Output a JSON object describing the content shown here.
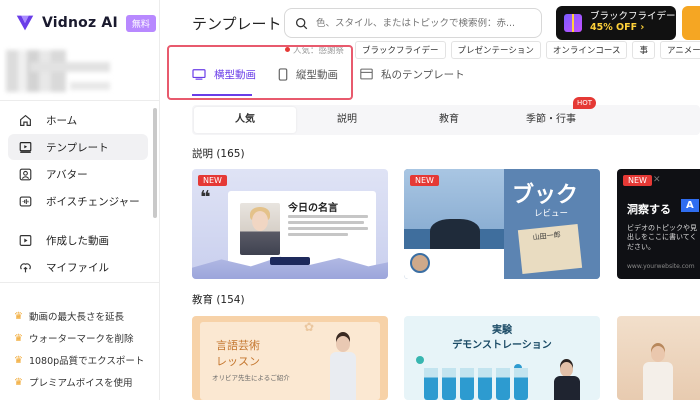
{
  "brand": {
    "name": "Vidnoz AI",
    "badge": "無料"
  },
  "sidebar": {
    "nav": [
      {
        "label": "ホーム",
        "icon": "home-icon"
      },
      {
        "label": "テンプレート",
        "icon": "template-icon",
        "active": true
      },
      {
        "label": "アバター",
        "icon": "avatar-icon"
      },
      {
        "label": "ボイスチェンジャー",
        "icon": "voice-changer-icon"
      },
      {
        "label": "作成した動画",
        "icon": "play-icon"
      },
      {
        "label": "マイファイル",
        "icon": "upload-icon"
      }
    ],
    "premium": [
      "動画の最大長さを延長",
      "ウォーターマークを削除",
      "1080p品質でエクスポート",
      "プレミアムボイスを使用"
    ]
  },
  "header": {
    "title": "テンプレート",
    "search_placeholder": "色、スタイル、またはトピックで検索例：赤...",
    "promo_title": "ブラックフライデー",
    "promo_sub": "45% OFF ›"
  },
  "tags": [
    "人気：感謝祭",
    "ブラックフライデー",
    "プレゼンテーション",
    "オンラインコース",
    "事",
    "アニメーション"
  ],
  "orientation_tabs": [
    {
      "label": "横型動画",
      "active": true
    },
    {
      "label": "縦型動画"
    },
    {
      "label": "私のテンプレート"
    }
  ],
  "categories": [
    {
      "label": "人気",
      "active": true
    },
    {
      "label": "説明"
    },
    {
      "label": "教育"
    },
    {
      "label": "季節・行事",
      "badge": "HOT"
    }
  ],
  "sections": [
    {
      "title": "説明 (165)",
      "cards": [
        {
          "badge": "NEW",
          "title": "今日の名言"
        },
        {
          "badge": "NEW",
          "title": "ブック",
          "subtitle": "レビュー",
          "note": "山田一郎"
        },
        {
          "badge": "NEW",
          "title": "洞察する",
          "accent": "A",
          "text": "ビデオのトピックや見出しをここに書いてください。",
          "url": "www.yourwebsite.com"
        }
      ]
    },
    {
      "title": "教育 (154)",
      "cards": [
        {
          "title_line1": "言語芸術",
          "title_line2": "レッスン",
          "sub": "オリビア先生によるご紹介"
        },
        {
          "title_line1": "実験",
          "title_line2": "デモンストレーション"
        },
        {
          "title": ""
        }
      ]
    }
  ],
  "colors": {
    "accent": "#6a3de8",
    "highlight_box": "#e85a6d",
    "new_badge": "#e53935",
    "premium_crown": "#f0a52b"
  }
}
